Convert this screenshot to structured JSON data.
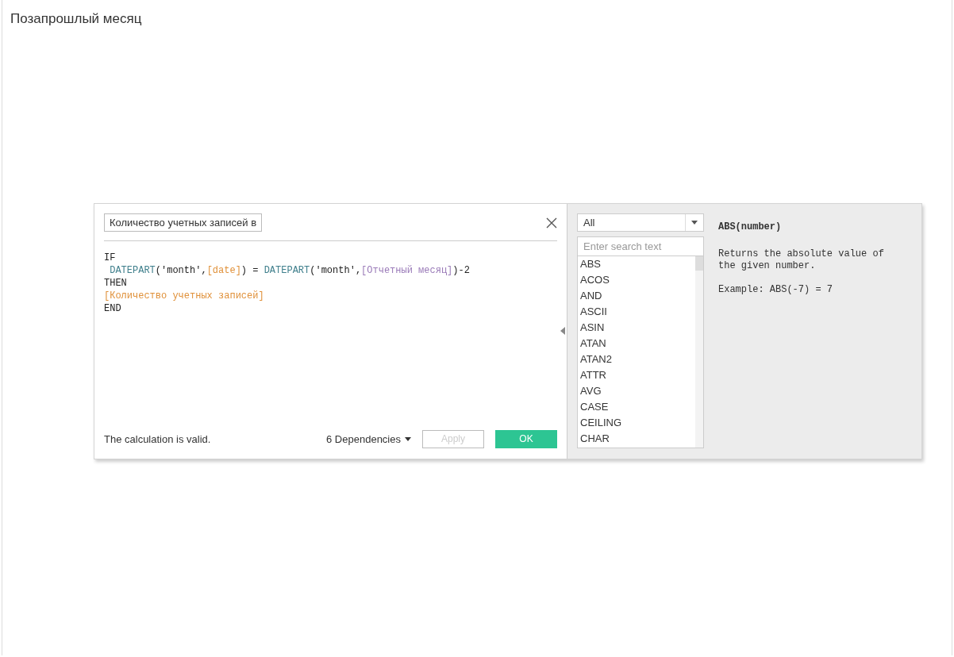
{
  "page": {
    "title": "Позапрошлый месяц"
  },
  "editor": {
    "name_field": "Количество учетных записей в",
    "code_lines": [
      [
        {
          "kind": "keyword",
          "text": "IF"
        }
      ],
      [
        {
          "kind": "function",
          "text": " DATEPART"
        },
        {
          "kind": "plain",
          "text": "('month',"
        },
        {
          "kind": "field",
          "text": "[date]"
        },
        {
          "kind": "plain",
          "text": ") = "
        },
        {
          "kind": "function",
          "text": "DATEPART"
        },
        {
          "kind": "plain",
          "text": "('month',"
        },
        {
          "kind": "parameter",
          "text": "[Отчетный месяц]"
        },
        {
          "kind": "plain",
          "text": ")-2"
        }
      ],
      [
        {
          "kind": "keyword",
          "text": "THEN"
        }
      ],
      [
        {
          "kind": "field",
          "text": "[Количество учетных записей]"
        }
      ],
      [
        {
          "kind": "keyword",
          "text": "END"
        }
      ]
    ],
    "status": "The calculation is valid.",
    "dependencies": "6 Dependencies",
    "buttons": [
      {
        "label": "Apply",
        "disabled": true,
        "kind": "secondary"
      },
      {
        "label": "OK",
        "disabled": false,
        "kind": "primary"
      }
    ]
  },
  "functions": {
    "category": "All",
    "search": {
      "placeholder": "Enter search text"
    },
    "items": [
      "ABS",
      "ACOS",
      "AND",
      "ASCII",
      "ASIN",
      "ATAN",
      "ATAN2",
      "ATTR",
      "AVG",
      "CASE",
      "CEILING",
      "CHAR"
    ],
    "help": {
      "signature": "ABS(number)",
      "description": "Returns the absolute value of the given number.",
      "example": "Example: ABS(-7) = 7"
    }
  }
}
